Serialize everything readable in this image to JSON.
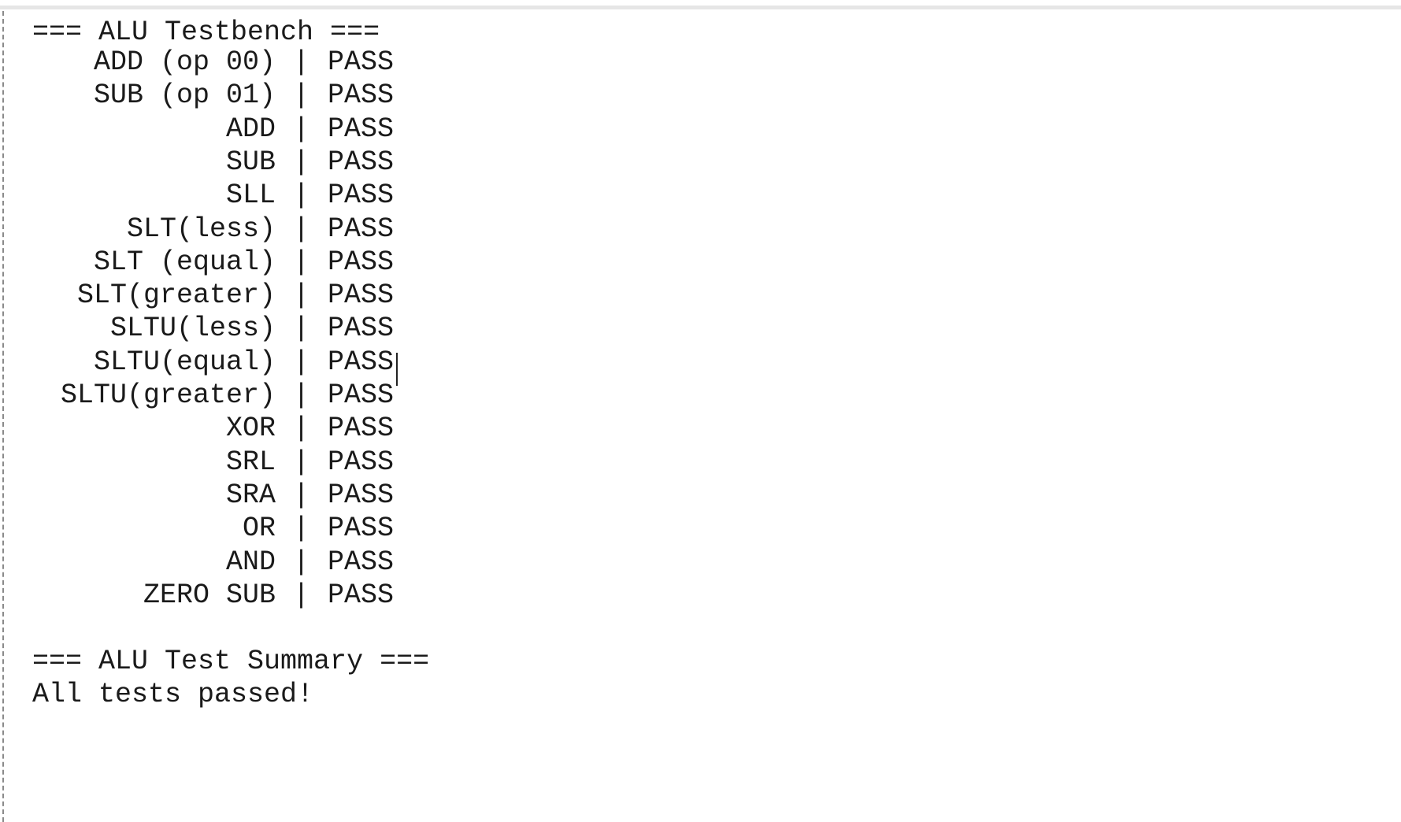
{
  "console": {
    "header": "=== ALU Testbench ===",
    "separator": "|",
    "results": [
      {
        "name": "ADD (op 00)",
        "status": "PASS"
      },
      {
        "name": "SUB (op 01)",
        "status": "PASS"
      },
      {
        "name": "ADD",
        "status": "PASS"
      },
      {
        "name": "SUB",
        "status": "PASS"
      },
      {
        "name": "SLL",
        "status": "PASS"
      },
      {
        "name": "SLT(less)",
        "status": "PASS"
      },
      {
        "name": "SLT (equal)",
        "status": "PASS"
      },
      {
        "name": "SLT(greater)",
        "status": "PASS"
      },
      {
        "name": "SLTU(less)",
        "status": "PASS"
      },
      {
        "name": "SLTU(equal)",
        "status": "PASS"
      },
      {
        "name": "SLTU(greater)",
        "status": "PASS"
      },
      {
        "name": "XOR",
        "status": "PASS"
      },
      {
        "name": "SRL",
        "status": "PASS"
      },
      {
        "name": "SRA",
        "status": "PASS"
      },
      {
        "name": "OR",
        "status": "PASS"
      },
      {
        "name": "AND",
        "status": "PASS"
      },
      {
        "name": "ZERO SUB",
        "status": "PASS"
      }
    ],
    "summary_header": "=== ALU Test Summary ===",
    "summary_message": "All tests passed!"
  }
}
